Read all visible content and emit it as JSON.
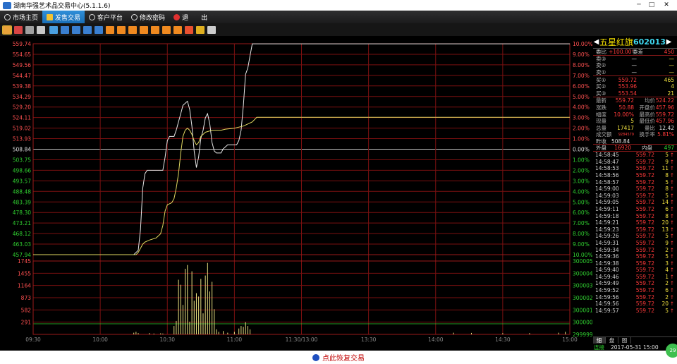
{
  "window": {
    "title": "湖南华强艺术品交易中心(5.1.1.6)"
  },
  "menu": [
    {
      "label": "市场主页",
      "icon": "globe-icon",
      "active": false
    },
    {
      "label": "发售交易",
      "icon": "yen-icon",
      "active": true
    },
    {
      "label": "客户平台",
      "icon": "globe-icon",
      "active": false
    },
    {
      "label": "修改密码",
      "icon": "lock-icon",
      "active": false
    },
    {
      "label": "退　　出",
      "icon": "power-icon",
      "active": false
    }
  ],
  "toolbar_colors": [
    "#e8a23a",
    "#d84545",
    "#a0a0a0",
    "#c8c8c8",
    "#4aa0e0",
    "#3a7fd0",
    "#3a7fd0",
    "#3a7fd0",
    "#3a7fd0",
    "#f08a20",
    "#f08a20",
    "#f08a20",
    "#f08a20",
    "#f08a20",
    "#f08a20",
    "#f08a20",
    "#e85030",
    "#e0b020",
    "#cccccc"
  ],
  "stock": {
    "name": "五星红旗",
    "code": "602013"
  },
  "quote": {
    "weibi_label": "委比",
    "weibi_val": "+100.00%",
    "weicha_label": "委差",
    "weicha_val": "450",
    "sell": [
      {
        "label": "卖③",
        "price": "—",
        "vol": "—"
      },
      {
        "label": "卖②",
        "price": "—",
        "vol": "—"
      },
      {
        "label": "卖①",
        "price": "—",
        "vol": "—"
      }
    ],
    "buy": [
      {
        "label": "买①",
        "price": "559.72",
        "vol": "465"
      },
      {
        "label": "买②",
        "price": "553.96",
        "vol": "4"
      },
      {
        "label": "买③",
        "price": "553.54",
        "vol": "21"
      }
    ],
    "stats": [
      {
        "l1": "最新",
        "v1": "559.72",
        "l2": "均价",
        "v2": "524.22"
      },
      {
        "l1": "涨跌",
        "v1": "50.88",
        "l2": "开盘价",
        "v2": "457.96"
      },
      {
        "l1": "幅度",
        "v1": "10.00%",
        "l2": "最高价",
        "v2": "559.72"
      },
      {
        "l1": "现量",
        "v1": "5",
        "l2": "最低价",
        "v2": "457.96"
      },
      {
        "l1": "总量",
        "v1": "17417",
        "l2": "量比",
        "v2": "12.42"
      },
      {
        "l1": "成交额",
        "v1": "9284579",
        "l2": "换手率",
        "v2": "5.81%"
      }
    ],
    "zuoshou_label": "昨收",
    "zuoshou_val": "508.84",
    "waipan_label": "外盘",
    "waipan_val": "16920",
    "neipan_label": "内盘",
    "neipan_val": "497"
  },
  "trades": [
    {
      "time": "14:58:45",
      "price": "559.72",
      "vol": "5"
    },
    {
      "time": "14:58:47",
      "price": "559.72",
      "vol": "9"
    },
    {
      "time": "14:58:53",
      "price": "559.72",
      "vol": "11"
    },
    {
      "time": "14:58:56",
      "price": "559.72",
      "vol": "8"
    },
    {
      "time": "14:58:57",
      "price": "559.72",
      "vol": "5"
    },
    {
      "time": "14:59:00",
      "price": "559.72",
      "vol": "8"
    },
    {
      "time": "14:59:03",
      "price": "559.72",
      "vol": "5"
    },
    {
      "time": "14:59:05",
      "price": "559.72",
      "vol": "14"
    },
    {
      "time": "14:59:11",
      "price": "559.72",
      "vol": "6"
    },
    {
      "time": "14:59:18",
      "price": "559.72",
      "vol": "8"
    },
    {
      "time": "14:59:21",
      "price": "559.72",
      "vol": "20"
    },
    {
      "time": "14:59:23",
      "price": "559.72",
      "vol": "13"
    },
    {
      "time": "14:59:26",
      "price": "559.72",
      "vol": "5"
    },
    {
      "time": "14:59:31",
      "price": "559.72",
      "vol": "9"
    },
    {
      "time": "14:59:34",
      "price": "559.72",
      "vol": "2"
    },
    {
      "time": "14:59:36",
      "price": "559.72",
      "vol": "5"
    },
    {
      "time": "14:59:38",
      "price": "559.72",
      "vol": "3"
    },
    {
      "time": "14:59:40",
      "price": "559.72",
      "vol": "4"
    },
    {
      "time": "14:59:46",
      "price": "559.72",
      "vol": "1"
    },
    {
      "time": "14:59:49",
      "price": "559.72",
      "vol": "2"
    },
    {
      "time": "14:59:52",
      "price": "559.72",
      "vol": "6"
    },
    {
      "time": "14:59:56",
      "price": "559.72",
      "vol": "2"
    },
    {
      "time": "14:59:56",
      "price": "559.72",
      "vol": "20"
    },
    {
      "time": "14:59:57",
      "price": "559.72",
      "vol": "5"
    }
  ],
  "trade_arrow": "↑",
  "panel_tabs": [
    "细",
    "盘",
    "图"
  ],
  "status": {
    "conn": "连接",
    "datetime": "2017-05-31 15:00"
  },
  "badge": "29",
  "bottom": {
    "label": "点此恢复交易"
  },
  "chart_data": {
    "type": "line",
    "price_ticks": [
      "559.74",
      "554.65",
      "549.56",
      "544.47",
      "539.38",
      "534.29",
      "529.20",
      "524.11",
      "519.02",
      "513.93",
      "508.84",
      "503.75",
      "498.66",
      "493.57",
      "488.48",
      "483.39",
      "478.30",
      "473.21",
      "468.12",
      "463.03",
      "457.94"
    ],
    "pct_ticks": [
      "10.00%",
      "9.00%",
      "8.00%",
      "7.00%",
      "6.00%",
      "5.00%",
      "4.00%",
      "3.00%",
      "2.00%",
      "1.00%",
      "0.00%",
      "1.00%",
      "2.00%",
      "3.00%",
      "4.00%",
      "5.00%",
      "6.00%",
      "7.00%",
      "8.00%",
      "9.00%",
      "10.00%"
    ],
    "vol_ticks_left": [
      "1745",
      "1455",
      "1164",
      "873",
      "582",
      "291"
    ],
    "vol_ticks_right": [
      "300005",
      "300004",
      "300003",
      "300002",
      "300001",
      "300000",
      "299999"
    ],
    "time_ticks": [
      "09:30",
      "10:00",
      "10:30",
      "11:00",
      "11:30/13:00",
      "13:30",
      "14:00",
      "14:30",
      "15:00"
    ],
    "ylim": [
      457.94,
      559.74
    ],
    "prev_close": 508.84,
    "series": [
      {
        "color": "#e8e8e8",
        "points": [
          [
            0,
            457.94
          ],
          [
            45,
            457.94
          ],
          [
            47,
            460
          ],
          [
            48,
            470
          ],
          [
            49,
            490
          ],
          [
            50,
            497
          ],
          [
            51,
            498.66
          ],
          [
            58,
            498.66
          ],
          [
            59,
            505
          ],
          [
            60,
            513
          ],
          [
            61,
            515
          ],
          [
            63,
            515
          ],
          [
            64,
            518
          ],
          [
            65,
            522
          ],
          [
            66,
            526
          ],
          [
            67,
            530
          ],
          [
            69,
            532
          ],
          [
            70,
            528
          ],
          [
            71,
            520
          ],
          [
            72,
            508
          ],
          [
            73,
            500
          ],
          [
            74,
            505
          ],
          [
            75,
            514
          ],
          [
            76,
            518
          ],
          [
            77,
            524
          ],
          [
            78,
            526
          ],
          [
            79,
            521
          ],
          [
            80,
            512
          ],
          [
            81,
            508
          ],
          [
            82,
            507
          ],
          [
            84,
            507
          ],
          [
            85,
            509
          ],
          [
            86,
            510
          ],
          [
            87,
            511
          ],
          [
            91,
            511
          ],
          [
            92,
            513
          ],
          [
            93,
            518
          ],
          [
            94,
            530
          ],
          [
            95,
            545
          ],
          [
            96,
            548
          ],
          [
            97,
            554
          ],
          [
            98,
            559.72
          ],
          [
            240,
            559.72
          ]
        ]
      },
      {
        "color": "#e0d860",
        "points": [
          [
            0,
            457.94
          ],
          [
            46,
            457.94
          ],
          [
            47,
            459
          ],
          [
            48,
            461
          ],
          [
            49,
            463
          ],
          [
            50,
            464
          ],
          [
            52,
            465
          ],
          [
            55,
            466
          ],
          [
            57,
            468
          ],
          [
            58,
            472
          ],
          [
            59,
            479
          ],
          [
            60,
            482
          ],
          [
            62,
            483
          ],
          [
            63,
            485
          ],
          [
            64,
            490
          ],
          [
            65,
            497
          ],
          [
            66,
            507
          ],
          [
            67,
            515
          ],
          [
            68,
            518
          ],
          [
            69,
            519
          ],
          [
            70,
            518
          ],
          [
            71,
            516
          ],
          [
            72,
            513
          ],
          [
            73,
            511
          ],
          [
            74,
            512
          ],
          [
            75,
            515
          ],
          [
            76,
            516
          ],
          [
            77,
            517
          ],
          [
            80,
            518
          ],
          [
            84,
            518
          ],
          [
            86,
            518.5
          ],
          [
            90,
            519
          ],
          [
            92,
            519.5
          ],
          [
            94,
            520
          ],
          [
            96,
            521
          ],
          [
            98,
            522
          ],
          [
            100,
            524.22
          ],
          [
            240,
            524.22
          ]
        ]
      }
    ],
    "volume": [
      [
        45,
        40
      ],
      [
        46,
        60
      ],
      [
        47,
        30
      ],
      [
        52,
        30
      ],
      [
        54,
        20
      ],
      [
        57,
        25
      ],
      [
        58,
        20
      ],
      [
        63,
        200
      ],
      [
        64,
        320
      ],
      [
        65,
        1300
      ],
      [
        66,
        1180
      ],
      [
        67,
        700
      ],
      [
        68,
        1560
      ],
      [
        69,
        1650
      ],
      [
        70,
        300
      ],
      [
        71,
        1500
      ],
      [
        72,
        800
      ],
      [
        73,
        980
      ],
      [
        74,
        900
      ],
      [
        75,
        1320
      ],
      [
        76,
        500
      ],
      [
        77,
        1400
      ],
      [
        78,
        1700
      ],
      [
        79,
        1020
      ],
      [
        80,
        1250
      ],
      [
        81,
        600
      ],
      [
        82,
        120
      ],
      [
        83,
        60
      ],
      [
        85,
        80
      ],
      [
        87,
        40
      ],
      [
        90,
        60
      ],
      [
        92,
        140
      ],
      [
        93,
        200
      ],
      [
        94,
        180
      ],
      [
        95,
        290
      ],
      [
        96,
        200
      ],
      [
        97,
        120
      ],
      [
        188,
        40
      ],
      [
        196,
        35
      ],
      [
        210,
        30
      ],
      [
        222,
        30
      ],
      [
        235,
        40
      ],
      [
        238,
        60
      ]
    ]
  }
}
